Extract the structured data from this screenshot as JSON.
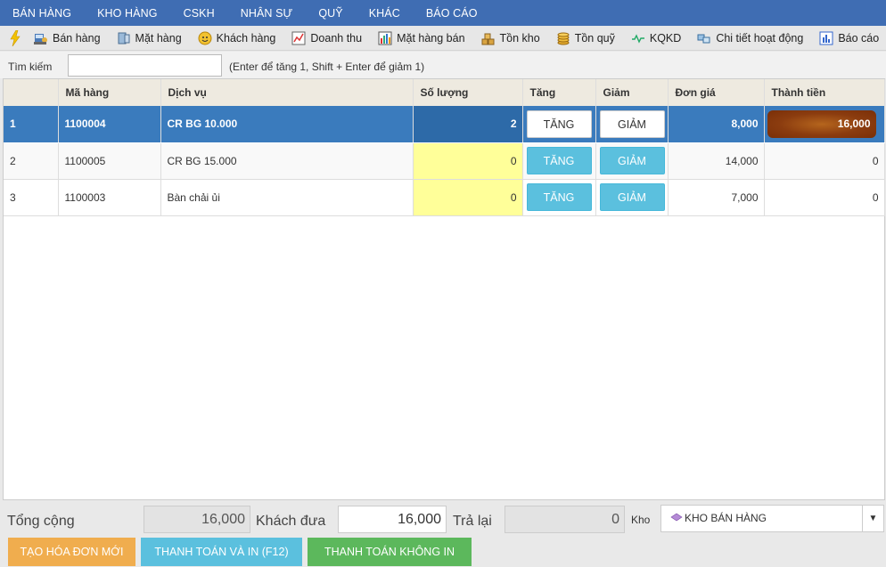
{
  "menu": [
    "BÁN HÀNG",
    "KHO HÀNG",
    "CSKH",
    "NHÂN SỰ",
    "QUỸ",
    "KHÁC",
    "BÁO CÁO"
  ],
  "toolbar": {
    "items": [
      {
        "label": "Bán hàng",
        "icon": "cashier-icon"
      },
      {
        "label": "Mặt hàng",
        "icon": "product-icon"
      },
      {
        "label": "Khách hàng",
        "icon": "customer-icon"
      },
      {
        "label": "Doanh thu",
        "icon": "revenue-icon"
      },
      {
        "label": "Mặt hàng bán",
        "icon": "sales-chart-icon"
      },
      {
        "label": "Tồn kho",
        "icon": "stock-icon"
      },
      {
        "label": "Tồn quỹ",
        "icon": "coins-icon"
      },
      {
        "label": "KQKD",
        "icon": "line-chart-icon"
      },
      {
        "label": "Chi tiết hoạt động",
        "icon": "activity-icon"
      },
      {
        "label": "Báo cáo",
        "icon": "report-icon"
      }
    ]
  },
  "search": {
    "label": "Tìm kiếm",
    "value": "",
    "hint": "(Enter để tăng 1, Shift + Enter để giảm 1)"
  },
  "table": {
    "headers": [
      "",
      "Mã hàng",
      "Dịch vụ",
      "Số lượng",
      "Tăng",
      "Giảm",
      "Đơn giá",
      "Thành tiền"
    ],
    "rows": [
      {
        "no": "1",
        "code": "1100004",
        "service": "CR BG 10.000",
        "qty": "2",
        "inc": "TĂNG",
        "dec": "GIẢM",
        "price": "8,000",
        "total": "16,000",
        "selected": true
      },
      {
        "no": "2",
        "code": "1100005",
        "service": "CR BG 15.000",
        "qty": "0",
        "inc": "TĂNG",
        "dec": "GIẢM",
        "price": "14,000",
        "total": "0",
        "selected": false
      },
      {
        "no": "3",
        "code": "1100003",
        "service": "Bàn chải ủi",
        "qty": "0",
        "inc": "TĂNG",
        "dec": "GIẢM",
        "price": "7,000",
        "total": "0",
        "selected": false
      }
    ]
  },
  "footer": {
    "total_label": "Tổng cộng",
    "total_value": "16,000",
    "paid_label": "Khách đưa",
    "paid_value": "16,000",
    "change_label": "Trả lại",
    "change_value": "0",
    "kho_label": "Kho",
    "kho_value": "KHO BÁN HÀNG",
    "buttons": [
      {
        "label": "TẠO HÓA ĐƠN MỚI",
        "color": "#f0ad4e"
      },
      {
        "label": "THANH TOÁN VÀ IN (F12)",
        "color": "#5bc0de"
      },
      {
        "label": "THANH TOÁN KHÔNG IN",
        "color": "#5cb85c"
      }
    ]
  },
  "colors": {
    "menubar": "#3f6db3",
    "selected_row": "#3a7bbd",
    "qty_yellow": "#ffff99"
  }
}
